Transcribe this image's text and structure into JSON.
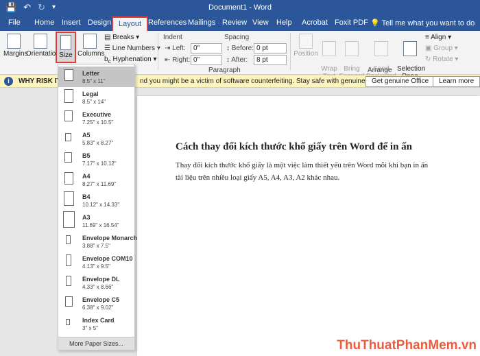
{
  "window": {
    "title": "Document1 - Word"
  },
  "qat": {
    "save_icon": "save-icon",
    "undo_icon": "undo-icon",
    "redo_icon": "redo-icon",
    "customize_icon": "customize-icon"
  },
  "tabs": [
    "File",
    "Home",
    "Insert",
    "Design",
    "Layout",
    "References",
    "Mailings",
    "Review",
    "View",
    "Help",
    "Acrobat",
    "Foxit PDF"
  ],
  "tell_me": "Tell me what you want to do",
  "ribbon": {
    "margins": "Margins",
    "orientation": "Orientation",
    "size": "Size",
    "columns": "Columns",
    "breaks": "Breaks",
    "line_numbers": "Line Numbers",
    "hyphenation": "Hyphenation",
    "indent_label": "Indent",
    "spacing_label": "Spacing",
    "left_label": "Left:",
    "right_label": "Right:",
    "before_label": "Before:",
    "after_label": "After:",
    "left_value": "0\"",
    "right_value": "0\"",
    "before_value": "0 pt",
    "after_value": "8 pt",
    "paragraph_group": "Paragraph",
    "position": "Position",
    "wrap_text": "Wrap\nText",
    "bring_forward": "Bring\nForward",
    "send_backward": "Send\nBackward",
    "selection_pane": "Selection\nPane",
    "align": "Align",
    "group": "Group",
    "rotate": "Rotate",
    "arrange_group": "Arrange"
  },
  "message_bar": {
    "warn": "WHY RISK IT?",
    "text": "nd you might be a victim of software counterfeiting. Stay safe with genuine Office today.",
    "btn_genuine": "Get genuine Office",
    "btn_learn": "Learn more"
  },
  "document": {
    "heading": "Cách thay đổi kích thước khổ giấy trên Word để in ấn",
    "body": "Thay đổi kích thước khổ giấy là một việc làm thiết yếu trên Word mỗi khi bạn in ấn tài liệu trên nhiều loại giấy A5, A4, A3, A2 khác nhau."
  },
  "size_menu": {
    "items": [
      {
        "name": "Letter",
        "dims": "8.5\" x 11\""
      },
      {
        "name": "Legal",
        "dims": "8.5\" x 14\""
      },
      {
        "name": "Executive",
        "dims": "7.25\" x 10.5\""
      },
      {
        "name": "A5",
        "dims": "5.83\" x 8.27\""
      },
      {
        "name": "B5",
        "dims": "7.17\" x 10.12\""
      },
      {
        "name": "A4",
        "dims": "8.27\" x 11.69\""
      },
      {
        "name": "B4",
        "dims": "10.12\" x 14.33\""
      },
      {
        "name": "A3",
        "dims": "11.69\" x 16.54\""
      },
      {
        "name": "Envelope Monarch",
        "dims": "3.88\" x 7.5\""
      },
      {
        "name": "Envelope COM10",
        "dims": "4.13\" x 9.5\""
      },
      {
        "name": "Envelope DL",
        "dims": "4.33\" x 8.66\""
      },
      {
        "name": "Envelope C5",
        "dims": "6.38\" x 9.02\""
      },
      {
        "name": "Index Card",
        "dims": "3\" x 5\""
      }
    ],
    "more": "More Paper Sizes..."
  },
  "watermark": "ThuThuatPhanMem.vn",
  "colors": {
    "accent": "#2b579a",
    "highlight_border": "#e03c3c",
    "message_bar": "#fcf4bd"
  }
}
